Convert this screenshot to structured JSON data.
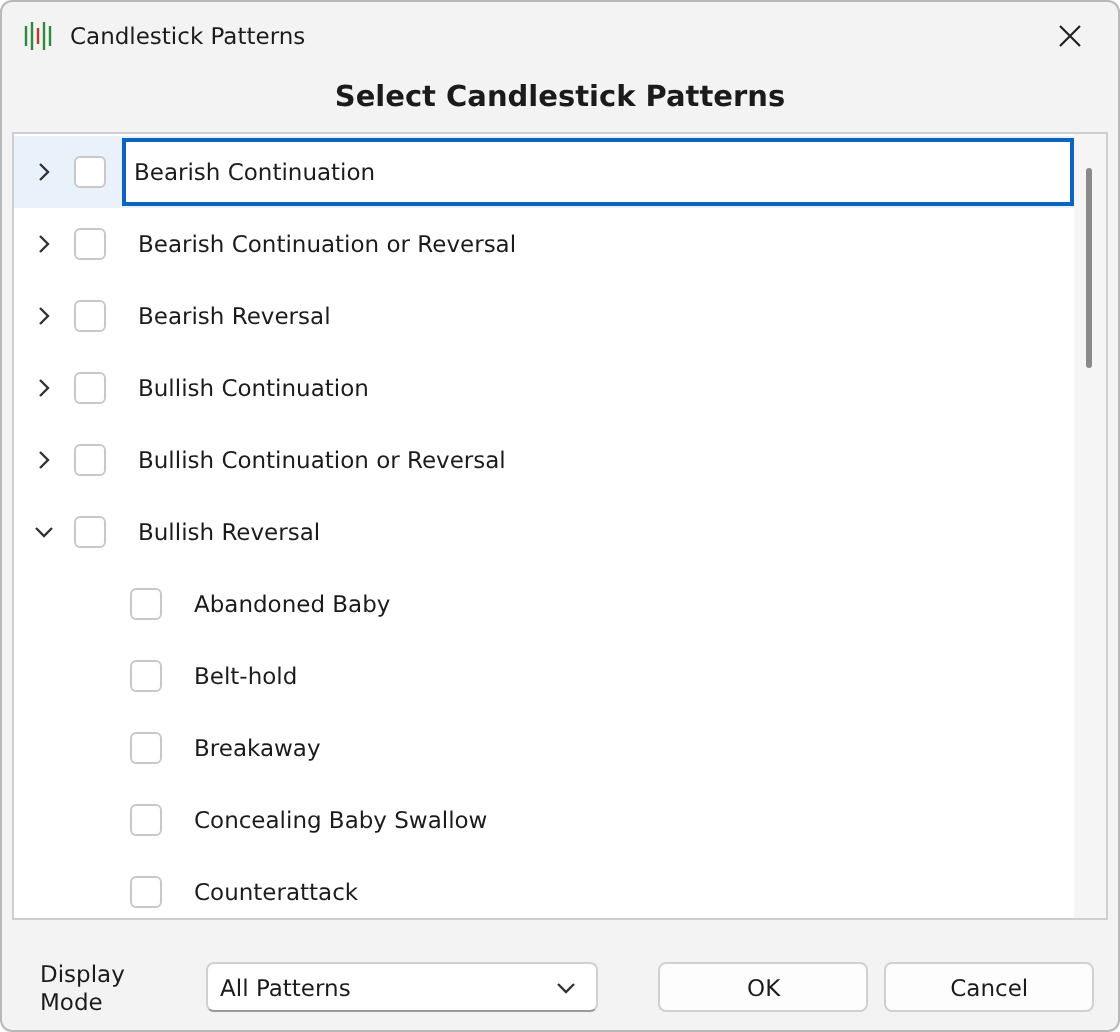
{
  "window": {
    "title": "Candlestick Patterns"
  },
  "heading": "Select Candlestick Patterns",
  "tree": [
    {
      "label": "Bearish Continuation",
      "checked": false,
      "expanded": false,
      "selected": true
    },
    {
      "label": "Bearish Continuation or Reversal",
      "checked": false,
      "expanded": false,
      "selected": false
    },
    {
      "label": "Bearish Reversal",
      "checked": false,
      "expanded": false,
      "selected": false
    },
    {
      "label": "Bullish Continuation",
      "checked": false,
      "expanded": false,
      "selected": false
    },
    {
      "label": "Bullish Continuation or Reversal",
      "checked": false,
      "expanded": false,
      "selected": false
    },
    {
      "label": "Bullish Reversal",
      "checked": false,
      "expanded": true,
      "selected": false,
      "children": [
        {
          "label": "Abandoned Baby",
          "checked": false,
          "selected": false
        },
        {
          "label": "Belt-hold",
          "checked": false,
          "selected": false
        },
        {
          "label": "Breakaway",
          "checked": false,
          "selected": false
        },
        {
          "label": "Concealing Baby Swallow",
          "checked": false,
          "selected": false
        },
        {
          "label": "Counterattack",
          "checked": false,
          "selected": false
        }
      ]
    }
  ],
  "footer": {
    "display_mode_label": "Display Mode",
    "display_mode_value": "All Patterns",
    "buttons": [
      "OK",
      "Cancel"
    ]
  }
}
